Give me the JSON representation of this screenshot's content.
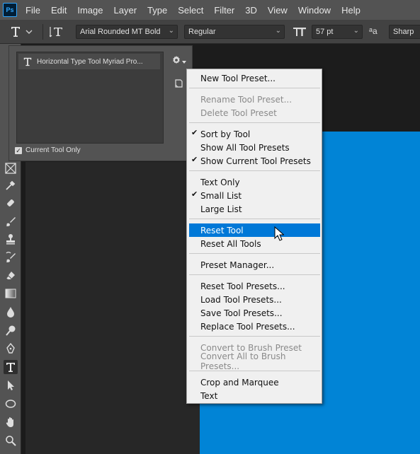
{
  "menubar": {
    "logo": "Ps",
    "items": [
      "File",
      "Edit",
      "Image",
      "Layer",
      "Type",
      "Select",
      "Filter",
      "3D",
      "View",
      "Window",
      "Help"
    ]
  },
  "options": {
    "font_family": "Arial Rounded MT Bold",
    "font_style": "Regular",
    "font_size": "57 pt",
    "aa_label": "a",
    "antialias": "Sharp"
  },
  "presets_panel": {
    "preset_name": "Horizontal Type Tool Myriad Pro...",
    "current_tool_only_label": "Current Tool Only",
    "current_tool_only_checked": true
  },
  "flyout": {
    "items": [
      {
        "label": "New Tool Preset...",
        "checked": false,
        "disabled": false
      },
      {
        "label": "Rename Tool Preset...",
        "checked": false,
        "disabled": true
      },
      {
        "label": "Delete Tool Preset",
        "checked": false,
        "disabled": true
      },
      {
        "label": "Sort by Tool",
        "checked": true,
        "disabled": false
      },
      {
        "label": "Show All Tool Presets",
        "checked": false,
        "disabled": false
      },
      {
        "label": "Show Current Tool Presets",
        "checked": true,
        "disabled": false
      },
      {
        "label": "Text Only",
        "checked": false,
        "disabled": false
      },
      {
        "label": "Small List",
        "checked": true,
        "disabled": false
      },
      {
        "label": "Large List",
        "checked": false,
        "disabled": false
      },
      {
        "label": "Reset Tool",
        "checked": false,
        "disabled": false,
        "highlighted": true
      },
      {
        "label": "Reset All Tools",
        "checked": false,
        "disabled": false
      },
      {
        "label": "Preset Manager...",
        "checked": false,
        "disabled": false
      },
      {
        "label": "Reset Tool Presets...",
        "checked": false,
        "disabled": false
      },
      {
        "label": "Load Tool Presets...",
        "checked": false,
        "disabled": false
      },
      {
        "label": "Save Tool Presets...",
        "checked": false,
        "disabled": false
      },
      {
        "label": "Replace Tool Presets...",
        "checked": false,
        "disabled": false
      },
      {
        "label": "Convert to Brush Preset",
        "checked": false,
        "disabled": true
      },
      {
        "label": "Convert All to Brush Presets...",
        "checked": false,
        "disabled": true
      },
      {
        "label": "Crop and Marquee",
        "checked": false,
        "disabled": false
      },
      {
        "label": "Text",
        "checked": false,
        "disabled": false
      }
    ],
    "check_glyph": "✔"
  },
  "colors": {
    "canvas_blue": "#0184d6",
    "highlight_blue": "#0078d7"
  }
}
